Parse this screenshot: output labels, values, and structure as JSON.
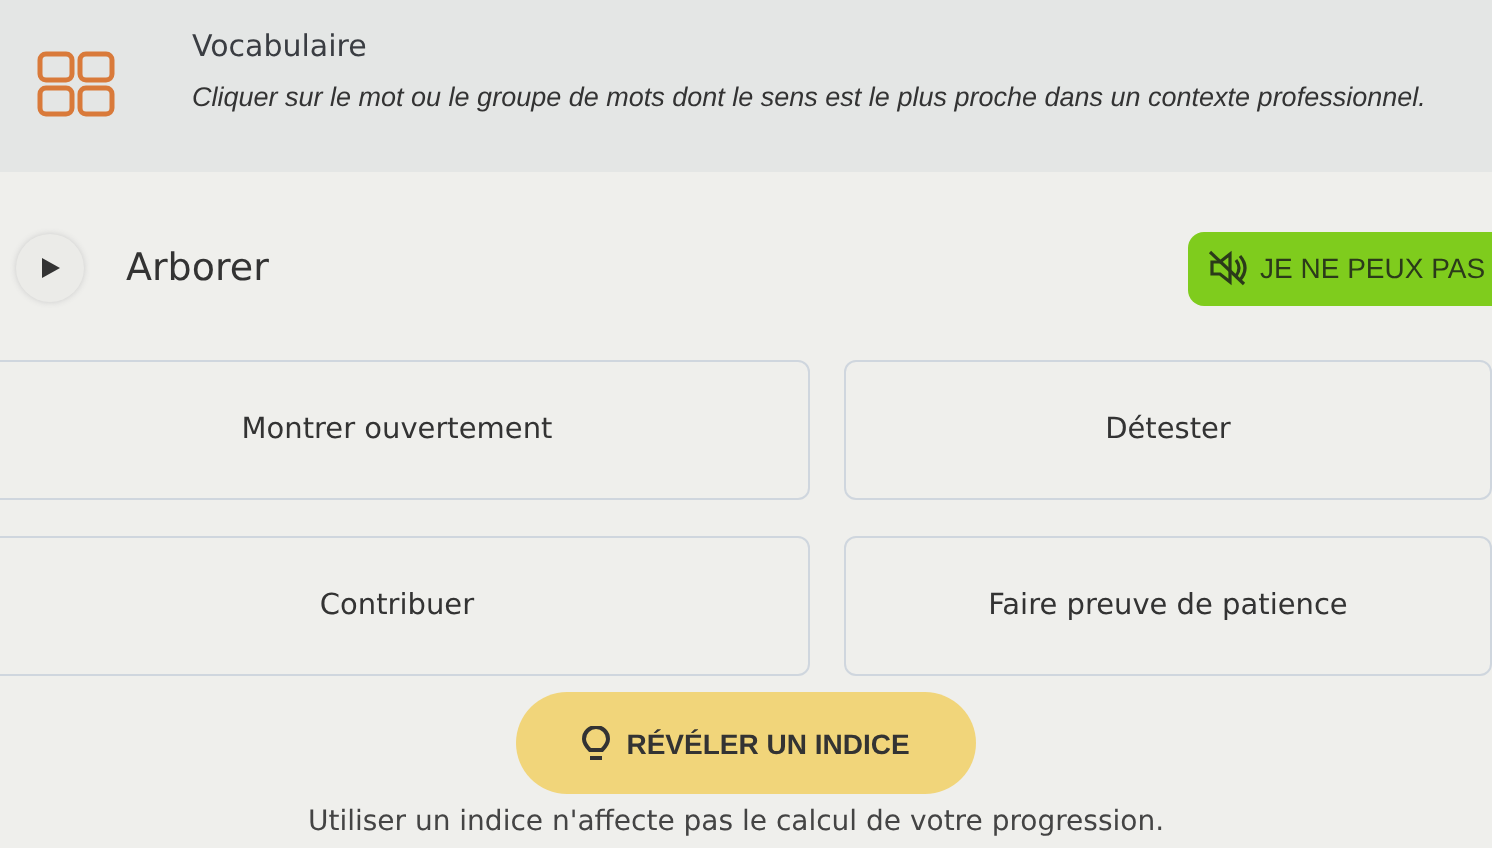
{
  "header": {
    "title": "Vocabulaire",
    "instruction": "Cliquer sur le mot ou le groupe de mots dont le sens est le plus proche dans un contexte professionnel."
  },
  "prompt": {
    "word": "Arborer"
  },
  "cant_listen_button": {
    "label": "JE NE PEUX PAS"
  },
  "options": [
    {
      "label": "Montrer ouvertement"
    },
    {
      "label": "Détester"
    },
    {
      "label": "Contribuer"
    },
    {
      "label": "Faire preuve de patience"
    }
  ],
  "hint_button": {
    "label": "RÉVÉLER UN INDICE"
  },
  "footnote": "Utiliser un indice n'affecte pas le calcul de votre progression."
}
